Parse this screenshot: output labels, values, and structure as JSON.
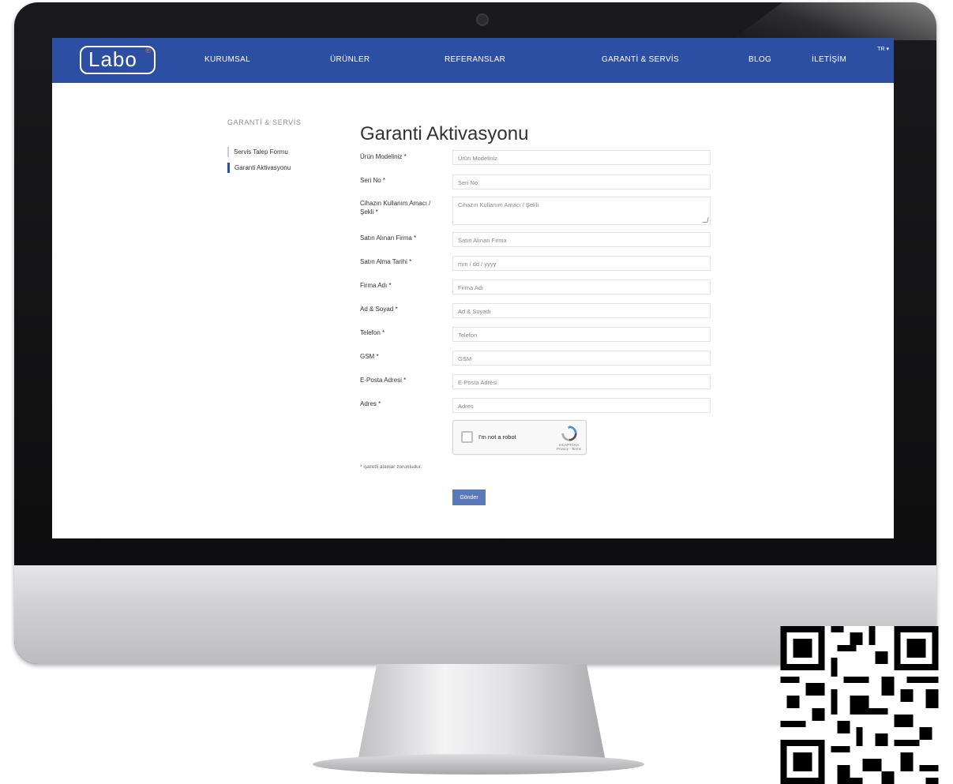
{
  "brand": {
    "logo_text": "Labo",
    "logo_mark": "®"
  },
  "nav": {
    "items": [
      "KURUMSAL",
      "ÜRÜNLER",
      "REFERANSLAR",
      "GARANTİ & SERVİS",
      "BLOG",
      "İLETİŞİM"
    ],
    "lang": "TR ▾"
  },
  "sidebar": {
    "heading": "GARANTİ & SERVİS",
    "links": [
      "Servis Talep Formu",
      "Garanti Aktivasyonu"
    ]
  },
  "page": {
    "title": "Garanti Aktivasyonu"
  },
  "form": {
    "fields": [
      {
        "label": "Ürün Modeliniz *",
        "placeholder": "Ürün Modeliniz"
      },
      {
        "label": "Seri No *",
        "placeholder": "Seri No"
      },
      {
        "label": "Cihazın Kullanım Amacı / Şekli *",
        "placeholder": "Cihazın Kullanım Amacı / Şekli"
      },
      {
        "label": "Satın Alınan Firma *",
        "placeholder": "Satın Alınan Firma"
      },
      {
        "label": "Satın Alma Tarihi *",
        "placeholder": "mm / dd / yyyy"
      },
      {
        "label": "Firma Adı *",
        "placeholder": "Firma Adı"
      },
      {
        "label": "Ad & Soyad *",
        "placeholder": "Ad & Soyadı"
      },
      {
        "label": "Telefon *",
        "placeholder": "Telefon"
      },
      {
        "label": "GSM *",
        "placeholder": "GSM"
      },
      {
        "label": "E-Posta Adresi *",
        "placeholder": "E-Posta Adresi"
      },
      {
        "label": "Adres *",
        "placeholder": "Adres"
      }
    ],
    "captcha": {
      "label": "I'm not a robot",
      "brand": "reCAPTCHA",
      "sub": "Privacy - Terms"
    },
    "required_note": "* işaretli alanlar zorunludur.",
    "submit_label": "Gönder"
  },
  "colors": {
    "nav_bg": "#2d4fa3",
    "button_bg": "#5b78b8",
    "logo_accent": "#e07a2c"
  }
}
